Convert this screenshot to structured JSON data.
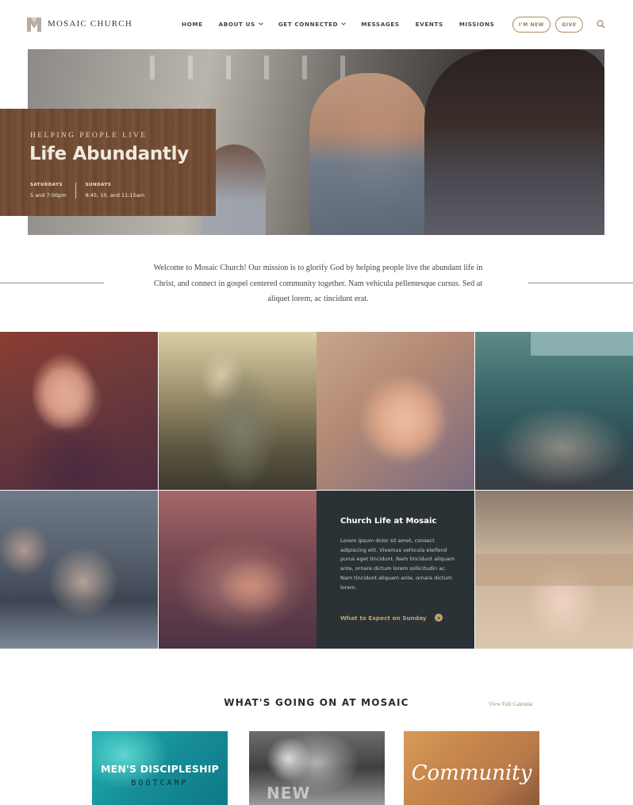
{
  "header": {
    "brand": "MOSAIC CHURCH",
    "nav": [
      {
        "label": "HOME",
        "dropdown": false
      },
      {
        "label": "ABOUT US",
        "dropdown": true
      },
      {
        "label": "GET CONNECTED",
        "dropdown": true
      },
      {
        "label": "MESSAGES",
        "dropdown": false
      },
      {
        "label": "EVENTS",
        "dropdown": false
      },
      {
        "label": "MISSIONS",
        "dropdown": false
      }
    ],
    "btn_new": "I'M NEW",
    "btn_give": "GIVE",
    "search_icon": "search-icon"
  },
  "hero": {
    "kicker": "HELPING PEOPLE LIVE",
    "title": "Life Abundantly",
    "times": [
      {
        "label": "SATURDAYS",
        "value": "5 and 7:00pm"
      },
      {
        "label": "SUNDAYS",
        "value": "8:45, 10, and 11:15am"
      }
    ]
  },
  "welcome": {
    "text": "Welcome to Mosaic Church! Our mission is to glorify God by helping people live the abundant life in Christ, and connect in gospel centered community together.  Nam vehicula pellentesque cursus. Sed at aliquet lorem, ac tincidunt erat."
  },
  "church_life": {
    "title": "Church Life at Mosaic",
    "body": "Lorem ipsum dolor sit amet, consect adipiscing elit. Vivamus vehicula eleifend purus eget tincidunt. Nam tincidunt aliquam ante, ornare dictum lorem sollicitudin ac. Nam tincidunt aliquam ante, ornare dictum lorem.",
    "link": "What to Expect on Sunday"
  },
  "events": {
    "title": "WHAT'S GOING ON AT MOSAIC",
    "view_calendar": "View Full Calendar",
    "cards": [
      {
        "title": "MEN'S DISCIPLESHIP",
        "subtitle": "BOOTCAMP"
      },
      {
        "title": "NEW"
      },
      {
        "title": "Community"
      }
    ]
  },
  "colors": {
    "accent": "#b08a5e",
    "dark_tile": "#2b3236",
    "wood": "#74503a"
  }
}
